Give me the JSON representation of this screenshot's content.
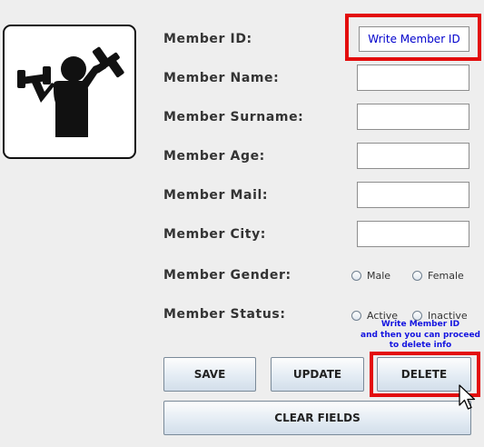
{
  "icons": {
    "logo": "weightlifter-icon",
    "cursor": "mouse-pointer-icon"
  },
  "form": {
    "member_id": {
      "label": "Member ID:",
      "value": "Write Member ID"
    },
    "member_name": {
      "label": "Member Name:",
      "value": ""
    },
    "member_surname": {
      "label": "Member Surname:",
      "value": ""
    },
    "member_age": {
      "label": "Member Age:",
      "value": ""
    },
    "member_mail": {
      "label": "Member Mail:",
      "value": ""
    },
    "member_city": {
      "label": "Member City:",
      "value": ""
    },
    "member_gender": {
      "label": "Member Gender:",
      "options": [
        "Male",
        "Female"
      ]
    },
    "member_status": {
      "label": "Member Status:",
      "options": [
        "Active",
        "Inactive"
      ]
    }
  },
  "hint": {
    "line1": "Write Member ID",
    "line2": "and then you can proceed",
    "line3": "to delete info"
  },
  "buttons": {
    "save": "SAVE",
    "update": "UPDATE",
    "delete": "DELETE",
    "clear": "CLEAR FIELDS"
  },
  "colors": {
    "highlight": "#e30c0c",
    "hint_text": "#1414e0",
    "id_text": "#0000cc",
    "background": "#eeeeee"
  }
}
